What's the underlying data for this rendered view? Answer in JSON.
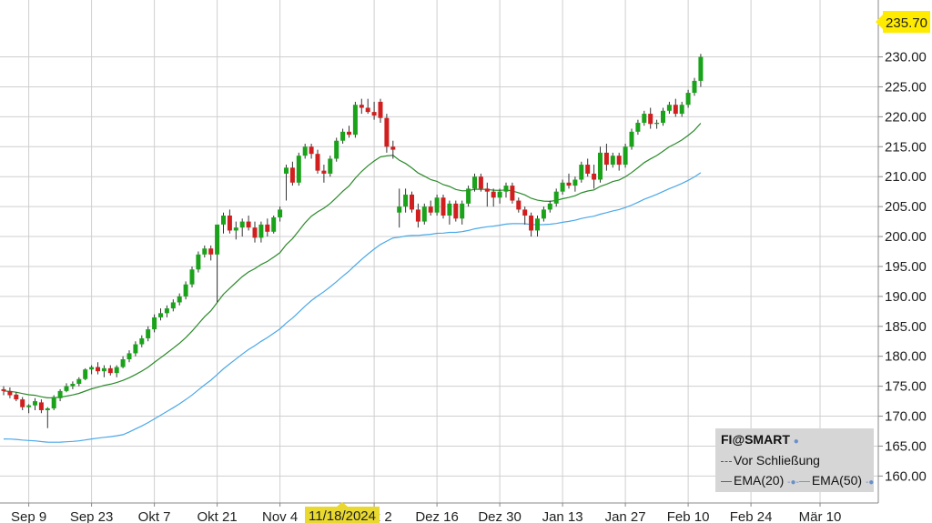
{
  "instrument": "FI@SMART",
  "last_price_label": "235.70",
  "crosshair_date_label": "11/18/2024",
  "legend": {
    "title": "FI@SMART",
    "close_label": "Vor Schließung",
    "ema20_label": "EMA(20)",
    "ema50_label": "EMA(50)"
  },
  "colors": {
    "up": "#1aa31a",
    "down": "#d11f1f",
    "ema20": "#2a8a2a",
    "ema50": "#4aa8e8",
    "grid": "#cfcfcf",
    "price_tag": "#ffeb00",
    "date_tag": "#e8d830"
  },
  "chart_data": {
    "type": "candlestick",
    "ylim": [
      155.5,
      239.5
    ],
    "y_ticks": [
      160.0,
      165.0,
      170.0,
      175.0,
      180.0,
      185.0,
      190.0,
      195.0,
      200.0,
      205.0,
      210.0,
      215.0,
      220.0,
      225.0,
      230.0
    ],
    "y_tick_labels": [
      "160.00",
      "165.00",
      "170.00",
      "175.00",
      "180.00",
      "185.00",
      "190.00",
      "195.00",
      "200.00",
      "205.00",
      "210.00",
      "215.00",
      "220.00",
      "225.00",
      "230.00"
    ],
    "x_tick_labels": [
      "Sep 9",
      "Sep 23",
      "Okt 7",
      "Okt 21",
      "Nov 4",
      "Dez 2",
      "Dez 16",
      "Dez 30",
      "Jan 13",
      "Jan 27",
      "Feb 10",
      "Feb 24",
      "Mär 10"
    ],
    "x_tick_index": [
      4,
      14,
      24,
      34,
      44,
      59,
      69,
      79,
      89,
      99,
      109,
      119,
      130
    ],
    "ohlc": [
      [
        174.5,
        175.0,
        173.5,
        174.2
      ],
      [
        174.2,
        174.8,
        173.0,
        173.5
      ],
      [
        173.6,
        174.0,
        172.5,
        172.8
      ],
      [
        172.8,
        173.2,
        171.0,
        171.5
      ],
      [
        171.5,
        172.0,
        170.5,
        171.8
      ],
      [
        171.8,
        173.0,
        171.0,
        172.5
      ],
      [
        172.3,
        172.8,
        170.5,
        171.0
      ],
      [
        171.0,
        171.5,
        168.0,
        171.3
      ],
      [
        171.3,
        173.5,
        171.0,
        173.2
      ],
      [
        173.0,
        174.5,
        172.5,
        174.2
      ],
      [
        174.2,
        175.5,
        174.0,
        175.0
      ],
      [
        175.0,
        175.8,
        174.5,
        175.4
      ],
      [
        175.4,
        176.5,
        175.0,
        176.2
      ],
      [
        176.2,
        178.0,
        176.0,
        177.8
      ],
      [
        177.8,
        178.5,
        177.0,
        178.2
      ],
      [
        178.2,
        179.0,
        177.0,
        177.5
      ],
      [
        177.5,
        178.5,
        176.5,
        178.0
      ],
      [
        178.0,
        178.5,
        176.8,
        177.2
      ],
      [
        177.2,
        178.5,
        176.5,
        178.2
      ],
      [
        178.2,
        180.0,
        178.0,
        179.5
      ],
      [
        179.5,
        181.0,
        179.0,
        180.5
      ],
      [
        180.5,
        182.5,
        180.0,
        182.0
      ],
      [
        182.0,
        183.5,
        181.5,
        183.0
      ],
      [
        183.0,
        185.0,
        182.5,
        184.5
      ],
      [
        184.5,
        187.0,
        184.0,
        186.5
      ],
      [
        186.5,
        188.0,
        186.0,
        187.2
      ],
      [
        187.2,
        188.5,
        186.5,
        188.0
      ],
      [
        188.0,
        189.5,
        187.5,
        189.0
      ],
      [
        189.0,
        190.5,
        188.5,
        190.0
      ],
      [
        190.0,
        192.5,
        189.5,
        192.0
      ],
      [
        192.0,
        195.0,
        191.5,
        194.5
      ],
      [
        194.5,
        197.5,
        194.0,
        197.0
      ],
      [
        197.0,
        198.5,
        196.5,
        198.0
      ],
      [
        198.0,
        198.5,
        196.0,
        197.0
      ],
      [
        197.0,
        199.0,
        189.0,
        202.0
      ],
      [
        202.0,
        204.0,
        200.5,
        203.5
      ],
      [
        203.5,
        204.5,
        200.5,
        201.0
      ],
      [
        201.0,
        202.5,
        199.5,
        201.5
      ],
      [
        201.5,
        203.0,
        200.0,
        202.5
      ],
      [
        202.5,
        203.5,
        201.0,
        201.5
      ],
      [
        201.5,
        202.5,
        199.0,
        199.8
      ],
      [
        199.8,
        202.5,
        199.0,
        202.0
      ],
      [
        202.0,
        203.0,
        200.0,
        200.8
      ],
      [
        200.8,
        203.5,
        200.5,
        203.2
      ],
      [
        203.2,
        205.0,
        202.5,
        204.5
      ],
      [
        210.5,
        212.0,
        206.0,
        211.5
      ],
      [
        211.5,
        212.5,
        208.5,
        209.0
      ],
      [
        209.0,
        214.0,
        208.5,
        213.5
      ],
      [
        213.5,
        215.5,
        213.0,
        215.0
      ],
      [
        215.0,
        215.5,
        213.0,
        213.8
      ],
      [
        213.8,
        214.5,
        210.5,
        211.0
      ],
      [
        211.0,
        212.0,
        209.0,
        210.5
      ],
      [
        210.5,
        213.5,
        210.0,
        213.0
      ],
      [
        213.0,
        216.5,
        212.5,
        216.0
      ],
      [
        216.0,
        218.0,
        215.5,
        217.5
      ],
      [
        217.5,
        218.5,
        216.5,
        217.0
      ],
      [
        217.0,
        222.5,
        216.5,
        222.0
      ],
      [
        222.0,
        223.0,
        220.5,
        221.5
      ],
      [
        221.5,
        223.0,
        220.5,
        220.8
      ],
      [
        220.8,
        222.5,
        219.5,
        220.2
      ],
      [
        222.5,
        223.0,
        219.0,
        219.8
      ],
      [
        219.8,
        220.5,
        214.0,
        215.0
      ],
      [
        215.0,
        216.0,
        213.0,
        214.5
      ],
      [
        204.0,
        208.0,
        201.5,
        205.0
      ],
      [
        205.0,
        208.0,
        204.0,
        207.0
      ],
      [
        207.0,
        207.5,
        204.0,
        204.5
      ],
      [
        204.5,
        205.5,
        201.5,
        202.5
      ],
      [
        202.5,
        205.5,
        202.0,
        205.0
      ],
      [
        205.0,
        206.0,
        203.5,
        204.0
      ],
      [
        204.0,
        207.0,
        203.5,
        206.5
      ],
      [
        206.5,
        207.0,
        203.0,
        203.5
      ],
      [
        203.5,
        206.0,
        202.0,
        205.5
      ],
      [
        205.5,
        206.0,
        202.5,
        203.0
      ],
      [
        203.0,
        206.0,
        202.0,
        205.5
      ],
      [
        205.5,
        208.5,
        205.0,
        208.0
      ],
      [
        208.0,
        210.5,
        207.5,
        210.0
      ],
      [
        210.0,
        210.5,
        207.5,
        208.0
      ],
      [
        208.0,
        209.0,
        205.0,
        207.5
      ],
      [
        207.5,
        208.0,
        205.0,
        206.5
      ],
      [
        206.5,
        208.0,
        205.5,
        207.5
      ],
      [
        207.5,
        209.0,
        206.5,
        208.5
      ],
      [
        208.5,
        209.0,
        205.5,
        206.0
      ],
      [
        206.0,
        206.5,
        204.0,
        204.5
      ],
      [
        204.5,
        205.0,
        202.0,
        203.5
      ],
      [
        203.5,
        204.0,
        200.0,
        201.0
      ],
      [
        201.0,
        203.5,
        200.0,
        203.0
      ],
      [
        203.0,
        205.0,
        202.5,
        204.5
      ],
      [
        204.5,
        206.0,
        204.0,
        205.5
      ],
      [
        205.5,
        208.0,
        205.0,
        207.5
      ],
      [
        207.5,
        209.5,
        207.0,
        209.0
      ],
      [
        209.0,
        210.5,
        208.0,
        208.5
      ],
      [
        208.5,
        210.0,
        207.5,
        209.5
      ],
      [
        209.5,
        212.5,
        209.0,
        212.0
      ],
      [
        212.0,
        213.0,
        210.0,
        210.5
      ],
      [
        210.5,
        212.0,
        208.0,
        209.5
      ],
      [
        209.5,
        215.0,
        209.0,
        214.0
      ],
      [
        214.0,
        215.5,
        211.0,
        212.0
      ],
      [
        212.0,
        214.0,
        211.5,
        213.5
      ],
      [
        213.5,
        214.0,
        211.0,
        212.0
      ],
      [
        212.0,
        215.5,
        211.5,
        215.0
      ],
      [
        215.0,
        218.0,
        214.5,
        217.5
      ],
      [
        217.5,
        219.5,
        217.0,
        219.0
      ],
      [
        219.0,
        221.0,
        218.5,
        220.5
      ],
      [
        220.5,
        221.5,
        218.0,
        218.8
      ],
      [
        218.8,
        219.5,
        218.0,
        219.0
      ],
      [
        219.0,
        221.5,
        218.5,
        221.0
      ],
      [
        221.0,
        222.5,
        220.5,
        222.0
      ],
      [
        222.0,
        223.0,
        220.0,
        220.5
      ],
      [
        220.5,
        222.5,
        220.0,
        222.0
      ],
      [
        222.0,
        224.5,
        221.5,
        224.0
      ],
      [
        224.0,
        226.5,
        223.5,
        226.0
      ],
      [
        226.0,
        230.5,
        225.0,
        230.0
      ]
    ]
  }
}
